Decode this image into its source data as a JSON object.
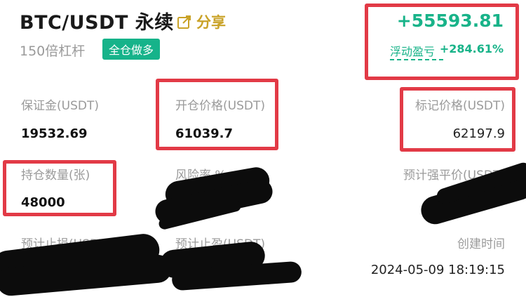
{
  "header": {
    "title": "BTC/USDT 永续",
    "share_label": "分享",
    "leverage": "150倍杠杆",
    "mode_badge": "全仓做多"
  },
  "pnl": {
    "value": "+55593.81",
    "label": "浮动盈亏",
    "percent": "+284.61%"
  },
  "fields": {
    "margin_label": "保证金(USDT)",
    "margin_value": "19532.69",
    "open_price_label": "开仓价格(USDT)",
    "open_price_value": "61039.7",
    "mark_price_label": "标记价格(USDT)",
    "mark_price_value": "62197.9",
    "position_label": "持仓数量(张)",
    "position_value": "48000",
    "risk_label": "风险率 %",
    "liq_label": "预计强平价(USDT)",
    "tp_label": "预计止损(USDT)",
    "sl_label": "预计止盈(USDT)",
    "created_label": "创建时间",
    "created_value": "2024-05-09 18:19:15"
  },
  "colors": {
    "accent_green": "#18b389",
    "share_gold": "#c9a227",
    "highlight_red": "#e23a46"
  },
  "icons": {
    "share": "share-external-icon"
  }
}
